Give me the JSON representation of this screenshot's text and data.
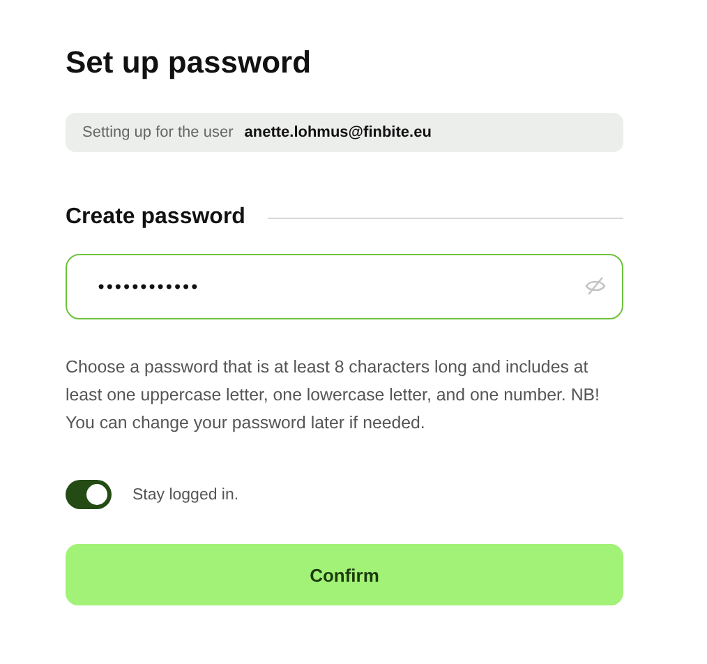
{
  "title": "Set up password",
  "user_info": {
    "label": "Setting up for the user",
    "email": "anette.lohmus@finbite.eu"
  },
  "section_heading": "Create password",
  "password_field": {
    "value": "••••••••••••",
    "focused": true
  },
  "help_text": "Choose a password that is at least 8 characters long and includes at least one uppercase letter, one lowercase letter, and one number. NB! You can change your password later if needed.",
  "stay_logged_in": {
    "label": "Stay logged in.",
    "on": true
  },
  "confirm_button": "Confirm"
}
